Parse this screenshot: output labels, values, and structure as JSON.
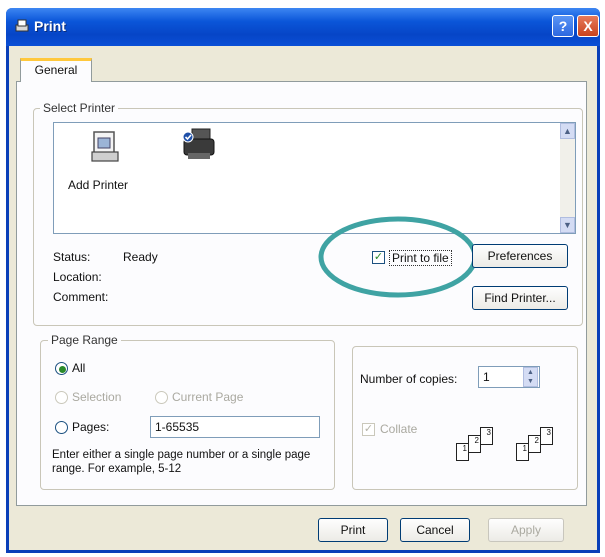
{
  "window": {
    "title": "Print",
    "help_glyph": "?",
    "close_glyph": "X"
  },
  "tabs": [
    {
      "label": "General"
    }
  ],
  "select_printer": {
    "legend": "Select Printer",
    "items": [
      {
        "label": "Add Printer",
        "icon": "add-printer-icon"
      },
      {
        "label": "",
        "icon": "printer-icon"
      }
    ],
    "status_label": "Status:",
    "status_value": "Ready",
    "location_label": "Location:",
    "comment_label": "Comment:",
    "print_to_file_label": "Print to file",
    "print_to_file_checked": true,
    "preferences_label": "Preferences",
    "find_printer_label": "Find Printer..."
  },
  "page_range": {
    "legend": "Page Range",
    "all_label": "All",
    "selection_label": "Selection",
    "current_page_label": "Current Page",
    "pages_label": "Pages:",
    "pages_value": "1-65535",
    "hint": "Enter either a single page number or a single page range.  For example, 5-12",
    "selected": "all"
  },
  "copies": {
    "label": "Number of copies:",
    "value": "1",
    "collate_label": "Collate",
    "collate_checked": true,
    "collate_pages": [
      "1",
      "2",
      "3"
    ]
  },
  "footer": {
    "print_label": "Print",
    "cancel_label": "Cancel",
    "apply_label": "Apply"
  },
  "annotation": {
    "color": "#3fa3a3"
  }
}
